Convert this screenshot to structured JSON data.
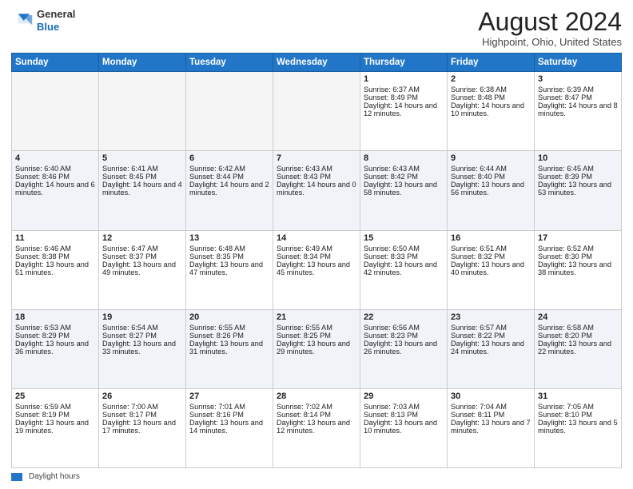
{
  "header": {
    "logo_general": "General",
    "logo_blue": "Blue",
    "month_title": "August 2024",
    "location": "Highpoint, Ohio, United States"
  },
  "days_of_week": [
    "Sunday",
    "Monday",
    "Tuesday",
    "Wednesday",
    "Thursday",
    "Friday",
    "Saturday"
  ],
  "footer": {
    "legend_label": "Daylight hours"
  },
  "weeks": [
    [
      {
        "day": "",
        "empty": true
      },
      {
        "day": "",
        "empty": true
      },
      {
        "day": "",
        "empty": true
      },
      {
        "day": "",
        "empty": true
      },
      {
        "day": "1",
        "sunrise": "Sunrise: 6:37 AM",
        "sunset": "Sunset: 8:49 PM",
        "daylight": "Daylight: 14 hours and 12 minutes."
      },
      {
        "day": "2",
        "sunrise": "Sunrise: 6:38 AM",
        "sunset": "Sunset: 8:48 PM",
        "daylight": "Daylight: 14 hours and 10 minutes."
      },
      {
        "day": "3",
        "sunrise": "Sunrise: 6:39 AM",
        "sunset": "Sunset: 8:47 PM",
        "daylight": "Daylight: 14 hours and 8 minutes."
      }
    ],
    [
      {
        "day": "4",
        "sunrise": "Sunrise: 6:40 AM",
        "sunset": "Sunset: 8:46 PM",
        "daylight": "Daylight: 14 hours and 6 minutes."
      },
      {
        "day": "5",
        "sunrise": "Sunrise: 6:41 AM",
        "sunset": "Sunset: 8:45 PM",
        "daylight": "Daylight: 14 hours and 4 minutes."
      },
      {
        "day": "6",
        "sunrise": "Sunrise: 6:42 AM",
        "sunset": "Sunset: 8:44 PM",
        "daylight": "Daylight: 14 hours and 2 minutes."
      },
      {
        "day": "7",
        "sunrise": "Sunrise: 6:43 AM",
        "sunset": "Sunset: 8:43 PM",
        "daylight": "Daylight: 14 hours and 0 minutes."
      },
      {
        "day": "8",
        "sunrise": "Sunrise: 6:43 AM",
        "sunset": "Sunset: 8:42 PM",
        "daylight": "Daylight: 13 hours and 58 minutes."
      },
      {
        "day": "9",
        "sunrise": "Sunrise: 6:44 AM",
        "sunset": "Sunset: 8:40 PM",
        "daylight": "Daylight: 13 hours and 56 minutes."
      },
      {
        "day": "10",
        "sunrise": "Sunrise: 6:45 AM",
        "sunset": "Sunset: 8:39 PM",
        "daylight": "Daylight: 13 hours and 53 minutes."
      }
    ],
    [
      {
        "day": "11",
        "sunrise": "Sunrise: 6:46 AM",
        "sunset": "Sunset: 8:38 PM",
        "daylight": "Daylight: 13 hours and 51 minutes."
      },
      {
        "day": "12",
        "sunrise": "Sunrise: 6:47 AM",
        "sunset": "Sunset: 8:37 PM",
        "daylight": "Daylight: 13 hours and 49 minutes."
      },
      {
        "day": "13",
        "sunrise": "Sunrise: 6:48 AM",
        "sunset": "Sunset: 8:35 PM",
        "daylight": "Daylight: 13 hours and 47 minutes."
      },
      {
        "day": "14",
        "sunrise": "Sunrise: 6:49 AM",
        "sunset": "Sunset: 8:34 PM",
        "daylight": "Daylight: 13 hours and 45 minutes."
      },
      {
        "day": "15",
        "sunrise": "Sunrise: 6:50 AM",
        "sunset": "Sunset: 8:33 PM",
        "daylight": "Daylight: 13 hours and 42 minutes."
      },
      {
        "day": "16",
        "sunrise": "Sunrise: 6:51 AM",
        "sunset": "Sunset: 8:32 PM",
        "daylight": "Daylight: 13 hours and 40 minutes."
      },
      {
        "day": "17",
        "sunrise": "Sunrise: 6:52 AM",
        "sunset": "Sunset: 8:30 PM",
        "daylight": "Daylight: 13 hours and 38 minutes."
      }
    ],
    [
      {
        "day": "18",
        "sunrise": "Sunrise: 6:53 AM",
        "sunset": "Sunset: 8:29 PM",
        "daylight": "Daylight: 13 hours and 36 minutes."
      },
      {
        "day": "19",
        "sunrise": "Sunrise: 6:54 AM",
        "sunset": "Sunset: 8:27 PM",
        "daylight": "Daylight: 13 hours and 33 minutes."
      },
      {
        "day": "20",
        "sunrise": "Sunrise: 6:55 AM",
        "sunset": "Sunset: 8:26 PM",
        "daylight": "Daylight: 13 hours and 31 minutes."
      },
      {
        "day": "21",
        "sunrise": "Sunrise: 6:55 AM",
        "sunset": "Sunset: 8:25 PM",
        "daylight": "Daylight: 13 hours and 29 minutes."
      },
      {
        "day": "22",
        "sunrise": "Sunrise: 6:56 AM",
        "sunset": "Sunset: 8:23 PM",
        "daylight": "Daylight: 13 hours and 26 minutes."
      },
      {
        "day": "23",
        "sunrise": "Sunrise: 6:57 AM",
        "sunset": "Sunset: 8:22 PM",
        "daylight": "Daylight: 13 hours and 24 minutes."
      },
      {
        "day": "24",
        "sunrise": "Sunrise: 6:58 AM",
        "sunset": "Sunset: 8:20 PM",
        "daylight": "Daylight: 13 hours and 22 minutes."
      }
    ],
    [
      {
        "day": "25",
        "sunrise": "Sunrise: 6:59 AM",
        "sunset": "Sunset: 8:19 PM",
        "daylight": "Daylight: 13 hours and 19 minutes."
      },
      {
        "day": "26",
        "sunrise": "Sunrise: 7:00 AM",
        "sunset": "Sunset: 8:17 PM",
        "daylight": "Daylight: 13 hours and 17 minutes."
      },
      {
        "day": "27",
        "sunrise": "Sunrise: 7:01 AM",
        "sunset": "Sunset: 8:16 PM",
        "daylight": "Daylight: 13 hours and 14 minutes."
      },
      {
        "day": "28",
        "sunrise": "Sunrise: 7:02 AM",
        "sunset": "Sunset: 8:14 PM",
        "daylight": "Daylight: 13 hours and 12 minutes."
      },
      {
        "day": "29",
        "sunrise": "Sunrise: 7:03 AM",
        "sunset": "Sunset: 8:13 PM",
        "daylight": "Daylight: 13 hours and 10 minutes."
      },
      {
        "day": "30",
        "sunrise": "Sunrise: 7:04 AM",
        "sunset": "Sunset: 8:11 PM",
        "daylight": "Daylight: 13 hours and 7 minutes."
      },
      {
        "day": "31",
        "sunrise": "Sunrise: 7:05 AM",
        "sunset": "Sunset: 8:10 PM",
        "daylight": "Daylight: 13 hours and 5 minutes."
      }
    ]
  ]
}
